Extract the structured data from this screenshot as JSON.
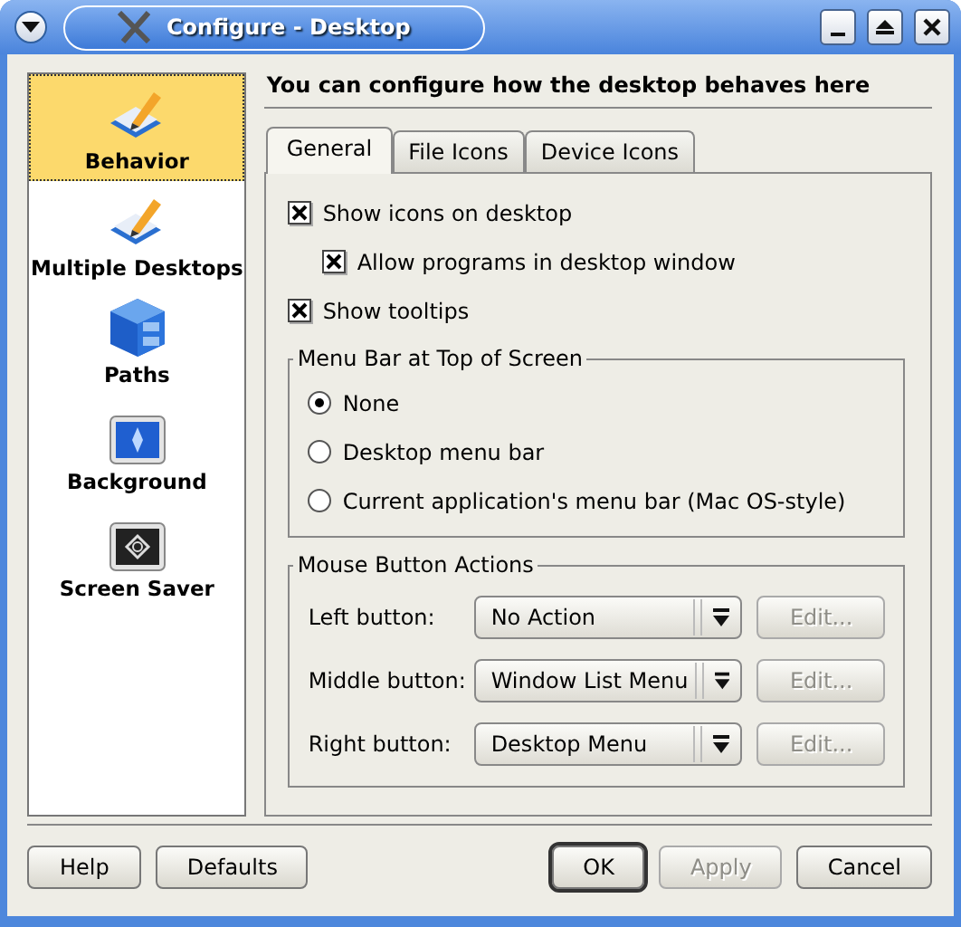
{
  "window": {
    "title": "Configure - Desktop"
  },
  "sidebar": {
    "items": [
      {
        "label": "Behavior",
        "kind": "pencil",
        "selected": true
      },
      {
        "label": "Multiple Desktops",
        "kind": "pencil",
        "selected": false
      },
      {
        "label": "Paths",
        "kind": "cabinet",
        "selected": false
      },
      {
        "label": "Background",
        "kind": "background",
        "selected": false
      },
      {
        "label": "Screen Saver",
        "kind": "screensaver",
        "selected": false
      }
    ]
  },
  "heading": "You can configure how the desktop behaves here",
  "tabs": [
    {
      "label": "General",
      "selected": true
    },
    {
      "label": "File Icons",
      "selected": false
    },
    {
      "label": "Device Icons",
      "selected": false
    }
  ],
  "options": [
    {
      "label": "Show icons on desktop",
      "checked": true,
      "children": [
        {
          "label": "Allow programs in desktop window",
          "checked": true
        }
      ]
    },
    {
      "label": "Show tooltips",
      "checked": true
    }
  ],
  "menu_bar_group": {
    "title": "Menu Bar at Top of Screen",
    "options": [
      {
        "label": "None",
        "selected": true
      },
      {
        "label": "Desktop menu bar",
        "selected": false
      },
      {
        "label": "Current application's menu bar (Mac OS-style)",
        "selected": false
      }
    ]
  },
  "mouse_group": {
    "title": "Mouse Button Actions",
    "rows": [
      {
        "label": "Left button:",
        "value": "No Action",
        "edit": {
          "label": "Edit...",
          "disabled": true
        }
      },
      {
        "label": "Middle button:",
        "value": "Window List Menu",
        "edit": {
          "label": "Edit...",
          "disabled": true
        }
      },
      {
        "label": "Right button:",
        "value": "Desktop Menu",
        "edit": {
          "label": "Edit...",
          "disabled": true
        }
      }
    ]
  },
  "buttons_left": [
    {
      "label": "Help",
      "disabled": false,
      "default": false
    },
    {
      "label": "Defaults",
      "disabled": false,
      "default": false
    }
  ],
  "buttons_right": [
    {
      "label": "OK",
      "disabled": false,
      "default": true
    },
    {
      "label": "Apply",
      "disabled": true,
      "default": false
    },
    {
      "label": "Cancel",
      "disabled": false,
      "default": false
    }
  ]
}
